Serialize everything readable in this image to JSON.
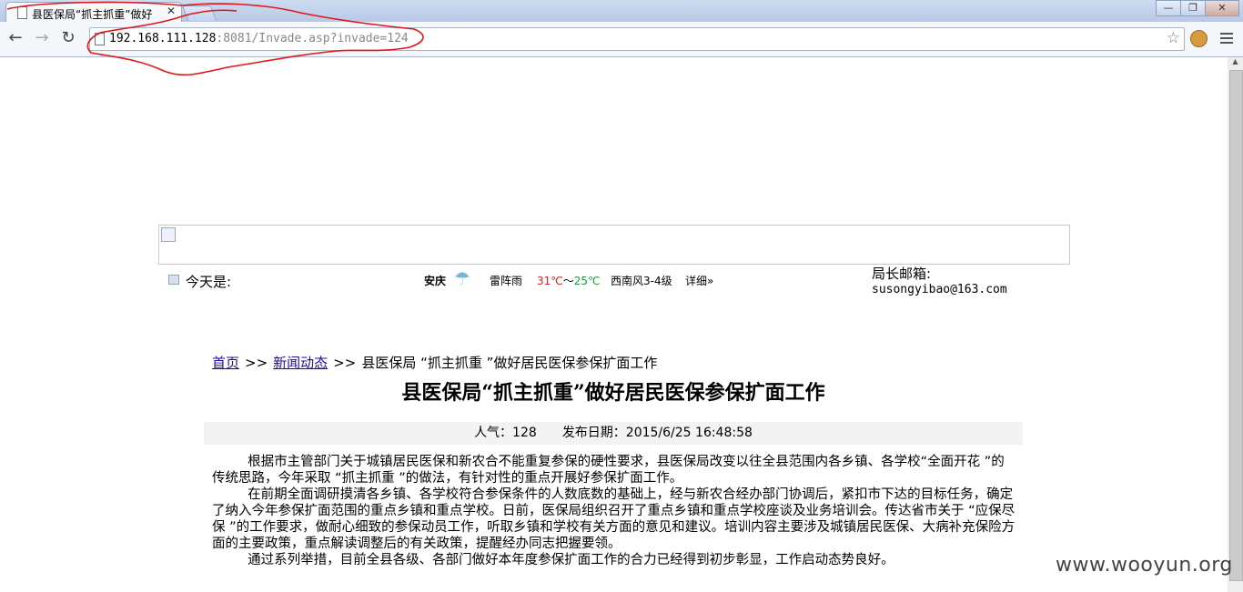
{
  "browser": {
    "tab_title": "县医保局“抓主抓重”做好",
    "url_host": "192.168.111.128",
    "url_rest": ":8081/Invade.asp?invade=124"
  },
  "page": {
    "today_label": "今天是:",
    "weather": {
      "city": "安庆",
      "condition": "雷阵雨",
      "temp_high": "31℃",
      "temp_sep": "～",
      "temp_low": "25℃",
      "wind": "西南风3-4级",
      "detail_link": "详细»"
    },
    "mailbox_label": "局长邮箱:",
    "mailbox_address": "susongyibao@163.com",
    "breadcrumb": {
      "home": "首页",
      "sep": ">>",
      "news": "新闻动态",
      "current": "县医保局 “抓主抓重 ”做好居民医保参保扩面工作"
    },
    "headline": "县医保局“抓主抓重”做好居民医保参保扩面工作",
    "meta": {
      "views": "人气：128",
      "date": "发布日期：2015/6/25 16:48:58"
    },
    "paragraphs": [
      "根据市主管部门关于城镇居民医保和新农合不能重复参保的硬性要求，县医保局改变以往全县范围内各乡镇、各学校“全面开花 ”的传统思路，今年采取 “抓主抓重 ”的做法，有针对性的重点开展好参保扩面工作。",
      "在前期全面调研摸清各乡镇、各学校符合参保条件的人数底数的基础上，经与新农合经办部门协调后，紧扣市下达的目标任务，确定了纳入今年参保扩面范围的重点乡镇和重点学校。日前，医保局组织召开了重点乡镇和重点学校座谈及业务培训会。传达省市关于 “应保尽保 ”的工作要求，做耐心细致的参保动员工作，听取乡镇和学校有关方面的意见和建议。培训内容主要涉及城镇居民医保、大病补充保险方面的主要政策，重点解读调整后的有关政策，提醒经办同志把握要领。",
      "通过系列举措，目前全县各级、各部门做好本年度参保扩面工作的合力已经得到初步彰显，工作启动态势良好。"
    ],
    "watermark": "www.wooyun.org"
  },
  "colors": {
    "annotation_red": "#e0161b",
    "temp_high": "#d62020",
    "temp_low": "#1a9a3a"
  }
}
